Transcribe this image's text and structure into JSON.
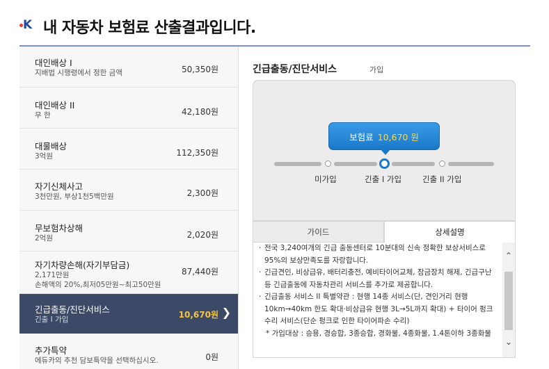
{
  "header": {
    "title": "내 자동차 보험료 산출결과입니다."
  },
  "coverages": [
    {
      "name": "대인배상 I",
      "sub": "지배법 시행령에서 정한 금액",
      "price": "50,350원"
    },
    {
      "name": "대인배상 II",
      "sub": "무 한",
      "price": "42,180원"
    },
    {
      "name": "대물배상",
      "sub": "3억원",
      "price": "112,350원"
    },
    {
      "name": "자기신체사고",
      "sub": "3천만원, 부상1천5백만원",
      "price": "2,300원"
    },
    {
      "name": "무보험차상해",
      "sub": "2억원",
      "price": "2,020원"
    },
    {
      "name": "자기차량손해(자기부담금)",
      "sub": "2,171만원",
      "sub2": "손해액의 20%,최저05만원~최고50만원",
      "price": "87,440원"
    },
    {
      "name": "긴급출동/진단서비스",
      "sub": "긴출 I 가입",
      "price": "10,670원",
      "active": true
    },
    {
      "name": "추가특약",
      "sub": "에듀카의 추천 담보특약을 선택하십시오.",
      "price": "0원"
    }
  ],
  "detail": {
    "title": "긴급출동/진단서비스",
    "tag": "가입",
    "bubble_label": "보험료",
    "bubble_amount": "10,670 원",
    "options": [
      "미가입",
      "긴출 I 가입",
      "긴출 II 가입"
    ],
    "selected_option": "긴출 I 가입",
    "tabs": [
      "가이드",
      "상세설명"
    ],
    "active_tab": "상세설명",
    "desc": [
      "전국 3,240여개의 긴급 출동센터로 10분대의 신속 정확한 보상서비스로 95%의 보상만족도를 자랑합니다.",
      "긴급견인, 비상급유, 배터리충전, 예비타이어교체, 잠금장치 해제, 긴급구난 등 긴급출동에 자동차관리 서비스를 추가로 제공합니다.",
      "긴급출동 서비스 II 특별약관 : 현행 14종 서비스(단, 견인거리 현행 10km→40km 한도 확대·비상급유 현행 3L→5L까지 확대) + 타이어 펑크수리 서비스(단순 펑크로 인한 타이어파손 수리)"
    ],
    "desc_note": "* 가입대상 : 승용, 경승합, 3종승합, 경화물, 4종화물, 1.4톤이하 3종화물"
  },
  "colors": {
    "accent": "#1a78c8",
    "active_bg": "#3c4a68",
    "price_highlight": "#f4c542"
  }
}
